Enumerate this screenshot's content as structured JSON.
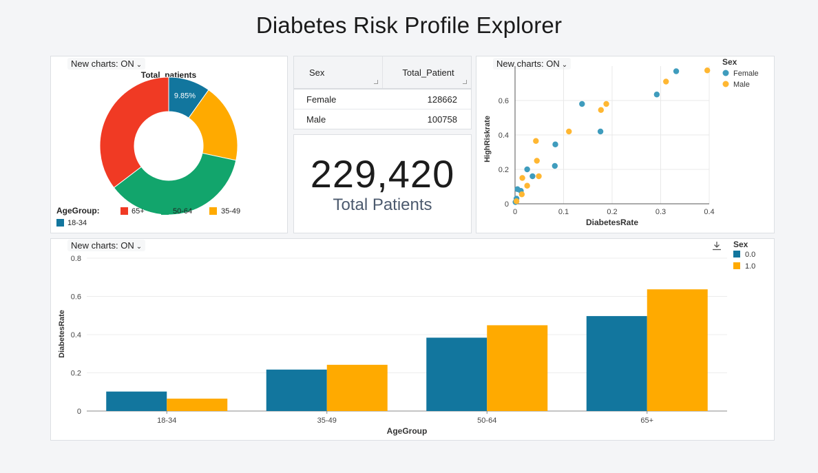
{
  "page_title": "Diabetes Risk Profile Explorer",
  "toggle_label": "New charts: ON",
  "donut": {
    "title": "Total_patients",
    "slice_label": "9.85%",
    "legend_title": "AgeGroup:",
    "legend": [
      {
        "label": "65+",
        "color": "#f03a24"
      },
      {
        "label": "50-64",
        "color": "#12a56c"
      },
      {
        "label": "35-49",
        "color": "#ffaa00"
      },
      {
        "label": "18-34",
        "color": "#12769e"
      }
    ]
  },
  "table": {
    "headers": [
      "Sex",
      "Total_Patient"
    ],
    "rows": [
      {
        "sex": "Female",
        "total": "128662"
      },
      {
        "sex": "Male",
        "total": "100758"
      }
    ]
  },
  "kpi": {
    "value": "229,420",
    "label": "Total Patients"
  },
  "scatter": {
    "xlabel": "DiabetesRate",
    "ylabel": "HighRiskrate",
    "legend_title": "Sex",
    "legend": [
      {
        "label": "Female",
        "color": "#3f9cbd"
      },
      {
        "label": "Male",
        "color": "#ffb732"
      }
    ]
  },
  "bar": {
    "legend_title": "Sex",
    "legend": [
      {
        "label": "0.0",
        "color": "#12769e"
      },
      {
        "label": "1.0",
        "color": "#ffaa00"
      }
    ]
  },
  "chart_data": [
    {
      "type": "pie",
      "title": "Total_patients",
      "categories": [
        "18-34",
        "35-49",
        "50-64",
        "65+"
      ],
      "values": [
        9.85,
        18.5,
        36.3,
        35.35
      ],
      "colors": [
        "#12769e",
        "#ffaa00",
        "#12a56c",
        "#f03a24"
      ],
      "data_labels": [
        "9.85%",
        "",
        "",
        ""
      ],
      "donut": true
    },
    {
      "type": "scatter",
      "xlabel": "DiabetesRate",
      "ylabel": "HighRiskrate",
      "xlim": [
        0,
        0.4
      ],
      "ylim": [
        0,
        0.8
      ],
      "xticks": [
        0,
        0.1,
        0.2,
        0.3,
        0.4
      ],
      "yticks": [
        0,
        0.2,
        0.4,
        0.6
      ],
      "grid": true,
      "legend_position": "top-right",
      "series": [
        {
          "name": "Female",
          "color": "#3f9cbd",
          "points": [
            [
              0.001,
              0.01
            ],
            [
              0.003,
              0.03
            ],
            [
              0.005,
              0.085
            ],
            [
              0.012,
              0.075
            ],
            [
              0.025,
              0.2
            ],
            [
              0.036,
              0.16
            ],
            [
              0.082,
              0.22
            ],
            [
              0.083,
              0.345
            ],
            [
              0.138,
              0.58
            ],
            [
              0.176,
              0.42
            ],
            [
              0.292,
              0.635
            ],
            [
              0.332,
              0.77
            ]
          ]
        },
        {
          "name": "Male",
          "color": "#ffb732",
          "points": [
            [
              0.003,
              0.015
            ],
            [
              0.014,
              0.055
            ],
            [
              0.015,
              0.15
            ],
            [
              0.025,
              0.105
            ],
            [
              0.043,
              0.365
            ],
            [
              0.045,
              0.25
            ],
            [
              0.049,
              0.16
            ],
            [
              0.111,
              0.42
            ],
            [
              0.177,
              0.545
            ],
            [
              0.188,
              0.58
            ],
            [
              0.311,
              0.71
            ],
            [
              0.396,
              0.775
            ]
          ]
        }
      ]
    },
    {
      "type": "bar",
      "xlabel": "AgeGroup",
      "ylabel": "DiabetesRate",
      "categories": [
        "18-34",
        "35-49",
        "50-64",
        "65+"
      ],
      "ylim": [
        0,
        0.8
      ],
      "yticks": [
        0,
        0.2,
        0.4,
        0.6,
        0.8
      ],
      "grid": true,
      "legend_position": "top-right",
      "series": [
        {
          "name": "0.0",
          "color": "#12769e",
          "values": [
            0.102,
            0.217,
            0.384,
            0.497
          ]
        },
        {
          "name": "1.0",
          "color": "#ffaa00",
          "values": [
            0.065,
            0.242,
            0.449,
            0.637
          ]
        }
      ]
    }
  ]
}
